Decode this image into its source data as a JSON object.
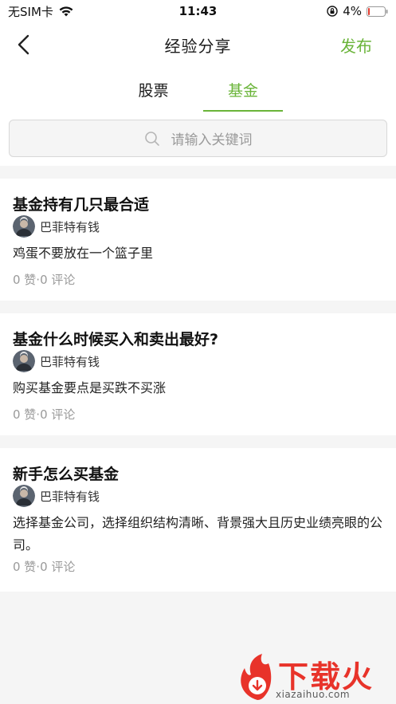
{
  "status_bar": {
    "carrier": "无SIM卡",
    "time": "11:43",
    "battery": "4%"
  },
  "nav": {
    "title": "经验分享",
    "publish_label": "发布"
  },
  "tabs": [
    {
      "label": "股票",
      "active": false
    },
    {
      "label": "基金",
      "active": true
    }
  ],
  "search": {
    "placeholder": "请输入关键词"
  },
  "posts": [
    {
      "title": "基金持有几只最合适",
      "author": "巴菲特有钱",
      "summary": "鸡蛋不要放在一个篮子里",
      "stats": "0 赞·0 评论"
    },
    {
      "title": "基金什么时候买入和卖出最好?",
      "author": "巴菲特有钱",
      "summary": "购买基金要点是买跌不买涨",
      "stats": "0 赞·0 评论"
    },
    {
      "title": "新手怎么买基金",
      "author": "巴菲特有钱",
      "summary": "选择基金公司，选择组织结构清晰、背景强大且历史业绩亮眼的公司。",
      "stats": "0 赞·0 评论"
    }
  ],
  "watermark": {
    "brand": "下载火",
    "url": "xiazaihuo.com"
  },
  "colors": {
    "accent": "#6ab439",
    "watermark": "#e8332a"
  }
}
